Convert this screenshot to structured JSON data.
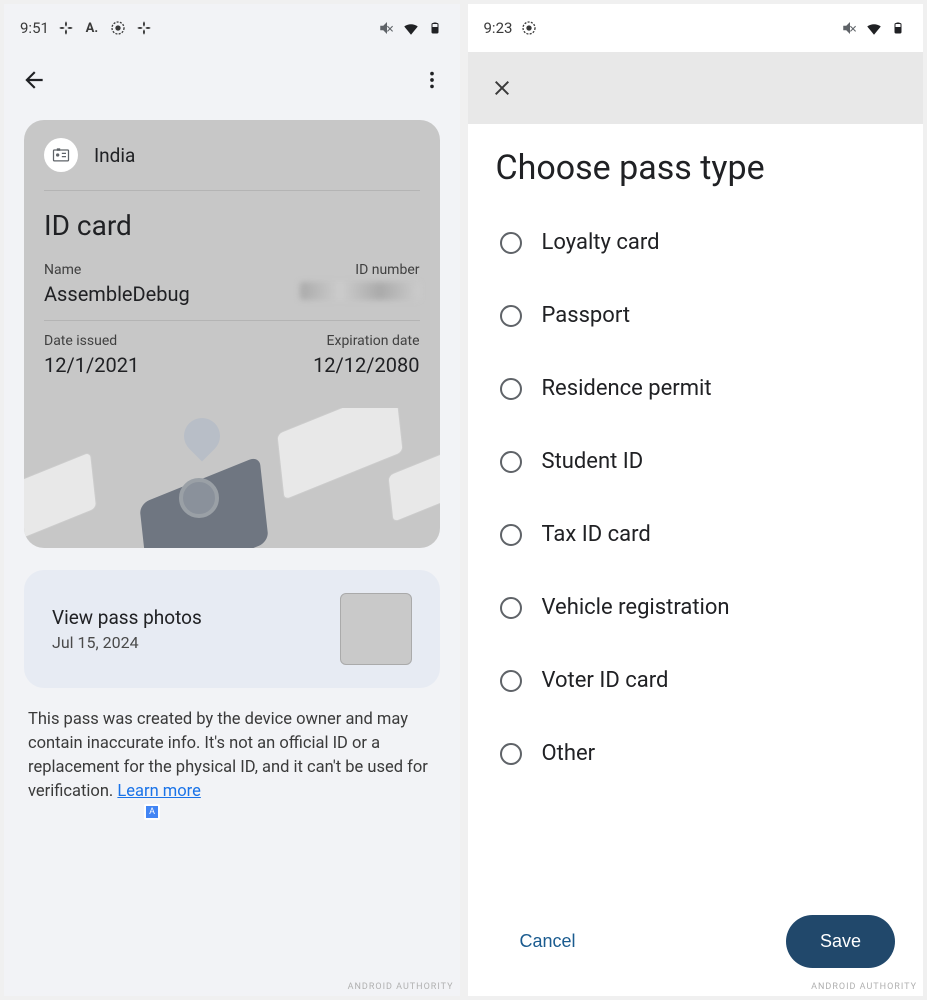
{
  "left": {
    "status": {
      "time": "9:51"
    },
    "card": {
      "country": "India",
      "type": "ID card",
      "name_label": "Name",
      "name_value": "AssembleDebug",
      "idnum_label": "ID number",
      "issued_label": "Date issued",
      "issued_value": "12/1/2021",
      "exp_label": "Expiration date",
      "exp_value": "12/12/2080"
    },
    "photos": {
      "title": "View pass photos",
      "date": "Jul 15, 2024"
    },
    "disclaimer": {
      "text": "This pass was created by the device owner and may contain inaccurate info. It's not an official ID or a replacement for the physical ID, and it can't be used for verification. ",
      "link": "Learn more"
    }
  },
  "right": {
    "status": {
      "time": "9:23"
    },
    "title": "Choose pass type",
    "options": [
      "Loyalty card",
      "Passport",
      "Residence permit",
      "Student ID",
      "Tax ID card",
      "Vehicle registration",
      "Voter ID card",
      "Other"
    ],
    "buttons": {
      "cancel": "Cancel",
      "save": "Save"
    }
  }
}
